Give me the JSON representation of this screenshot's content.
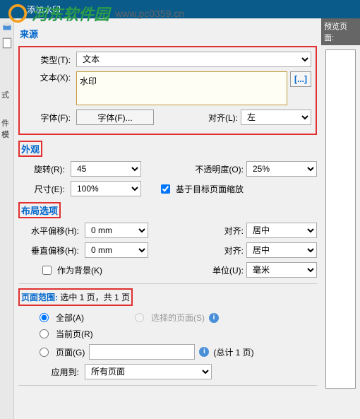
{
  "header": {
    "site_name": "河东软件园",
    "site_url": "www.pc0359.cn"
  },
  "title_bar": "添加水印",
  "left_tabs": {
    "t1": "式",
    "t2": "件模"
  },
  "preview": {
    "header": "预览页面:"
  },
  "source": {
    "title": "来源",
    "type_label": "类型(T):",
    "type_value": "文本",
    "text_label": "文本(X):",
    "text_value": "水印",
    "font_label": "字体(F):",
    "font_btn": "字体(F)...",
    "align_label": "对齐(L):",
    "align_value": "左"
  },
  "appearance": {
    "title": "外观",
    "rotate_label": "旋转(R):",
    "rotate_value": "45",
    "opacity_label": "不透明度(O):",
    "opacity_value": "25%",
    "size_label": "尺寸(E):",
    "size_value": "100%",
    "scale_chk": "基于目标页面缩放"
  },
  "layout": {
    "title": "布局选项",
    "hoffset_label": "水平偏移(H):",
    "hoffset_value": "0 mm",
    "voffset_label": "垂直偏移(H):",
    "voffset_value": "0 mm",
    "align1_label": "对齐:",
    "align1_value": "居中",
    "align2_label": "对齐:",
    "align2_value": "居中",
    "bg_chk": "作为背景(K)",
    "unit_label": "单位(U):",
    "unit_value": "毫米"
  },
  "range": {
    "title_prefix": "页面范围:",
    "title_rest": " 选中 1 页，共 1 页",
    "all": "全部(A)",
    "selected": "选择的页面(S)",
    "current": "当前页(R)",
    "pages": "页面(G)",
    "total": "(总计 1 页)",
    "apply_label": "应用到:",
    "apply_value": "所有页面"
  }
}
